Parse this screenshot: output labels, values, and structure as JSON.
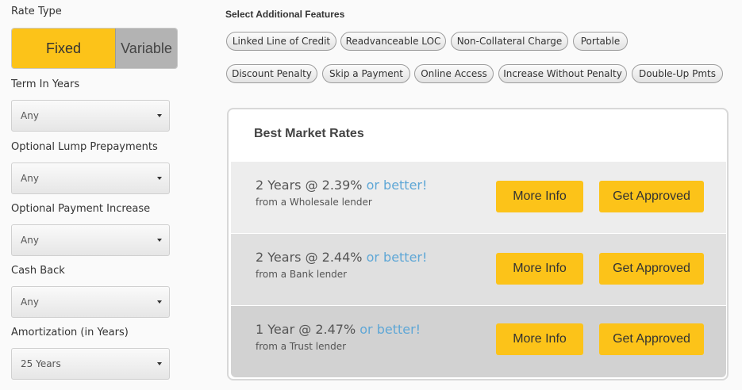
{
  "left": {
    "rate_type_label": "Rate Type",
    "rate_type_options": [
      "Fixed",
      "Variable"
    ],
    "rate_type_selected": "Fixed",
    "term_label": "Term In Years",
    "term_value": "Any",
    "lump_label": "Optional Lump Prepayments",
    "lump_value": "Any",
    "payment_increase_label": "Optional Payment Increase",
    "payment_increase_value": "Any",
    "cash_back_label": "Cash Back",
    "cash_back_value": "Any",
    "amortization_label": "Amortization (in Years)",
    "amortization_value": "25 Years"
  },
  "features": {
    "title": "Select Additional Features",
    "chips": [
      "Linked Line of Credit",
      "Readvanceable LOC",
      "Non-Collateral Charge",
      "Portable",
      "Discount Penalty",
      "Skip a Payment",
      "Online Access",
      "Increase Without Penalty",
      "Double-Up Pmts"
    ]
  },
  "rates": {
    "title": "Best Market Rates",
    "more_info_label": "More Info",
    "get_approved_label": "Get Approved",
    "rows": [
      {
        "rate": "2 Years @ 2.39%",
        "better": "or better!",
        "source": "from a Wholesale lender"
      },
      {
        "rate": "2 Years @ 2.44%",
        "better": "or better!",
        "source": "from a Bank lender"
      },
      {
        "rate": "1 Year @ 2.47%",
        "better": "or better!",
        "source": "from a Trust lender"
      }
    ]
  },
  "colors": {
    "accent": "#fcc319",
    "link": "#5fa7d6",
    "row_backgrounds": [
      "#ededed",
      "#e0e0e0",
      "#d2d2d2"
    ]
  }
}
